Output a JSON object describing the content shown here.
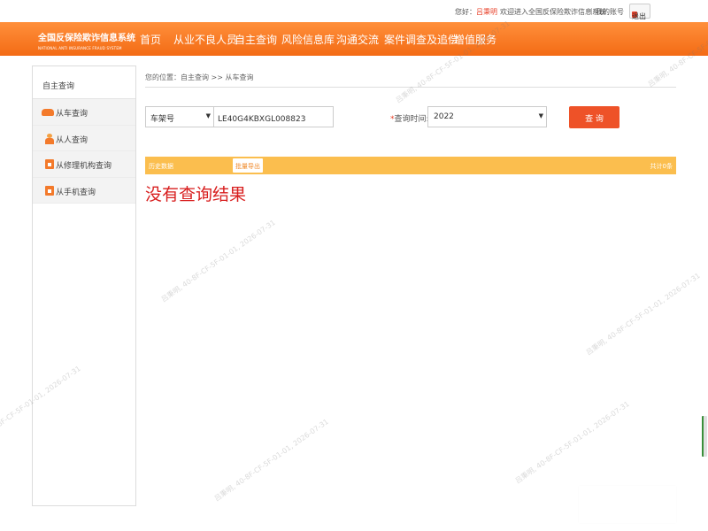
{
  "topbar": {
    "greeting": "您好：",
    "username": "吕秉明",
    "welcome": "欢迎进入全国反保险欺诈信息系统",
    "separator": "|",
    "my_account": "我的账号",
    "logout": "退出"
  },
  "logo": {
    "title_cn": "全国反保险欺诈信息系统",
    "title_en": "NATIONAL ANTI INSURANCE FRAUD SYSTEM"
  },
  "nav": {
    "items": [
      "首页",
      "从业不良人员",
      "自主查询",
      "风险信息库",
      "沟通交流",
      "案件调查及追偿",
      "增值服务"
    ]
  },
  "sidebar": {
    "header": "自主查询",
    "items": [
      "从车查询",
      "从人查询",
      "从修理机构查询",
      "从手机查询"
    ]
  },
  "breadcrumb": "您的位置：自主查询 >> 从车查询",
  "search": {
    "type_value": "车架号",
    "vin_value": "LE40G4KBXGL008823",
    "time_label": "查询时间:",
    "year_value": "2022",
    "query_button": "查 询"
  },
  "results": {
    "history_label": "历史数据",
    "export_button": "批量导出",
    "total_text": "共计0条",
    "empty_message": "没有查询结果"
  },
  "watermark": {
    "text": "吕秉明, 40-8F-CF-5F-01-01, 2026-07-31"
  }
}
